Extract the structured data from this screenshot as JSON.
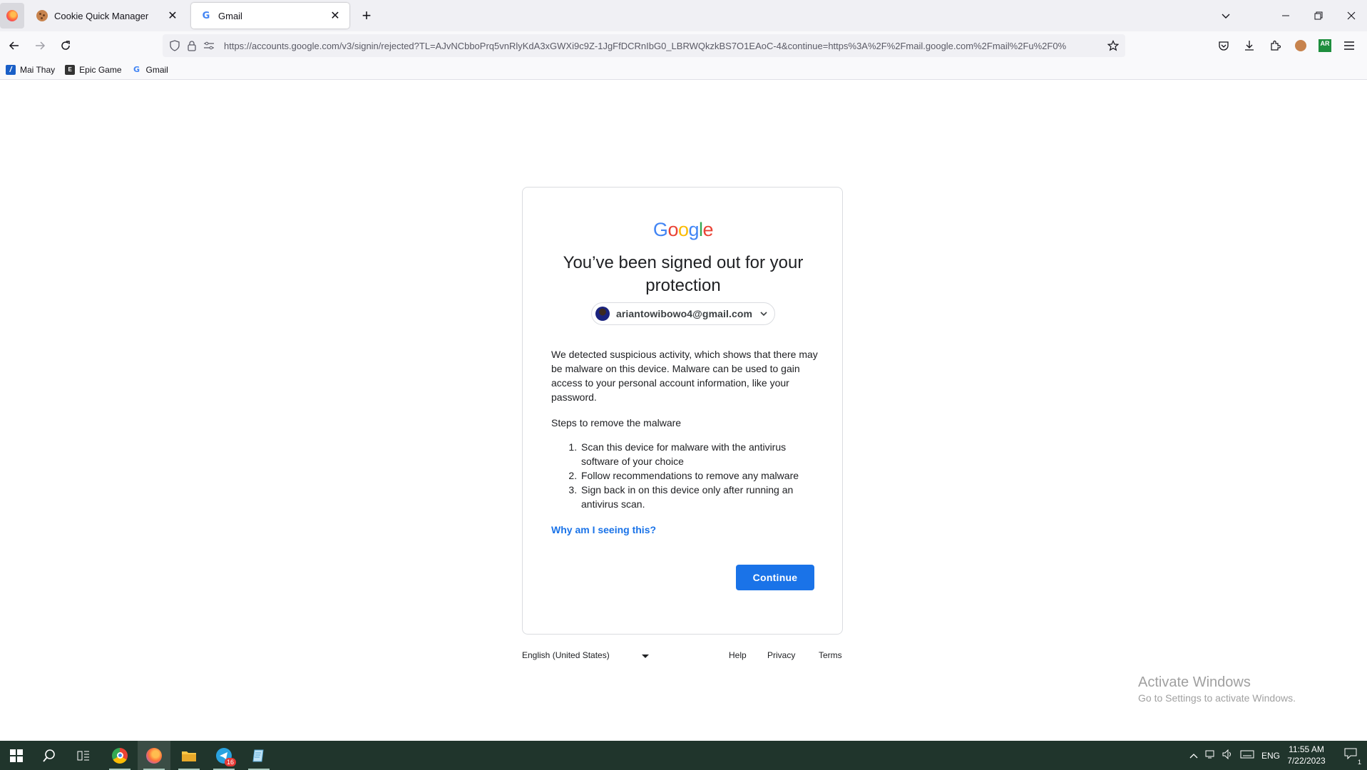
{
  "browser": {
    "tabs": [
      {
        "title": "Cookie Quick Manager",
        "icon": "cookie-icon",
        "active": false
      },
      {
        "title": "Gmail",
        "icon": "google-g-icon",
        "active": true
      }
    ],
    "url": "https://accounts.google.com/v3/signin/rejected?TL=AJvNCbboPrq5vnRlyKdA3xGWXi9c9Z-1JgFfDCRnIbG0_LBRWQkzkBS7O1EAoC-4&continue=https%3A%2F%2Fmail.google.com%2Fmail%2Fu%2F0%",
    "bookmarks": [
      {
        "label": "Mai Thay",
        "icon": "bookmark-slash-icon"
      },
      {
        "label": "Epic Game",
        "icon": "epic-games-icon"
      },
      {
        "label": "Gmail",
        "icon": "google-g-icon"
      }
    ],
    "extension_badge": "AR"
  },
  "signin": {
    "logo": {
      "letters": [
        "G",
        "o",
        "o",
        "g",
        "l",
        "e"
      ],
      "colors": [
        "#4285F4",
        "#EA4335",
        "#FBBC05",
        "#4285F4",
        "#34A853",
        "#EA4335"
      ]
    },
    "title": "You’ve been signed out for your protection",
    "account_email": "ariantowibowo4@gmail.com",
    "paragraph": "We detected suspicious activity, which shows that there may be malware on this device. Malware can be used to gain access to your personal account information, like your password.",
    "steps_heading": "Steps to remove the malware",
    "steps": [
      "Scan this device for malware with the antivirus software of your choice",
      "Follow recommendations to remove any malware",
      "Sign back in on this device only after running an antivirus scan."
    ],
    "why_link": "Why am I seeing this?",
    "continue_label": "Continue",
    "primary_color": "#1A73E8"
  },
  "footer": {
    "language": "English (United States)",
    "links": [
      "Help",
      "Privacy",
      "Terms"
    ]
  },
  "watermark": {
    "line1": "Activate Windows",
    "line2": "Go to Settings to activate Windows."
  },
  "taskbar": {
    "telegram_badge": "16",
    "language": "ENG",
    "time": "11:55 AM",
    "date": "7/22/2023",
    "notification_count": "1"
  }
}
